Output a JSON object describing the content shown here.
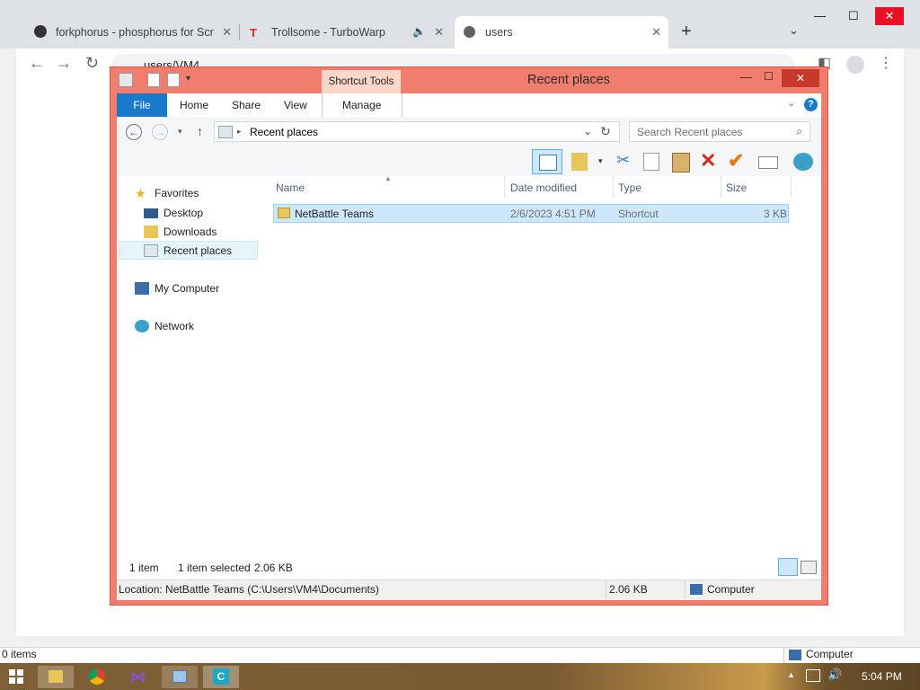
{
  "browser": {
    "tabs": [
      {
        "label": "forkphorus - phosphorus for Scra",
        "icon": "forkphorus-icon"
      },
      {
        "label": "Trollsome - TurboWarp",
        "icon": "turbowarp-icon"
      },
      {
        "label": "users",
        "icon": "globe-icon"
      }
    ],
    "url": "users/VM4"
  },
  "explorer": {
    "title": "Recent places",
    "contextual_tab": "Shortcut Tools",
    "ribbon_tabs": [
      "File",
      "Home",
      "Share",
      "View",
      "Manage"
    ],
    "address": "Recent places",
    "search_placeholder": "Search Recent places",
    "nav": {
      "favorites": "Favorites",
      "desktop": "Desktop",
      "downloads": "Downloads",
      "recent": "Recent places",
      "computer": "My Computer",
      "network": "Network"
    },
    "columns": [
      "Name",
      "Date modified",
      "Type",
      "Size"
    ],
    "files": [
      {
        "name": "NetBattle Teams",
        "date": "2/6/2023 4:51 PM",
        "type": "Shortcut",
        "size": "3 KB"
      }
    ],
    "status": {
      "count": "1 item",
      "selected": "1 item selected",
      "selected_size": "2.06 KB"
    },
    "details": {
      "location": "Location: NetBattle Teams (C:\\Users\\VM4\\Documents)",
      "size": "2.06 KB",
      "zone": "Computer"
    }
  },
  "outer_status": {
    "items": "0 items",
    "zone": "Computer"
  },
  "taskbar": {
    "clock": "5:04 PM"
  },
  "colors": {
    "window_frame": "#f17d6f",
    "file_tab": "#1979ca",
    "selection": "#cce8ff"
  }
}
